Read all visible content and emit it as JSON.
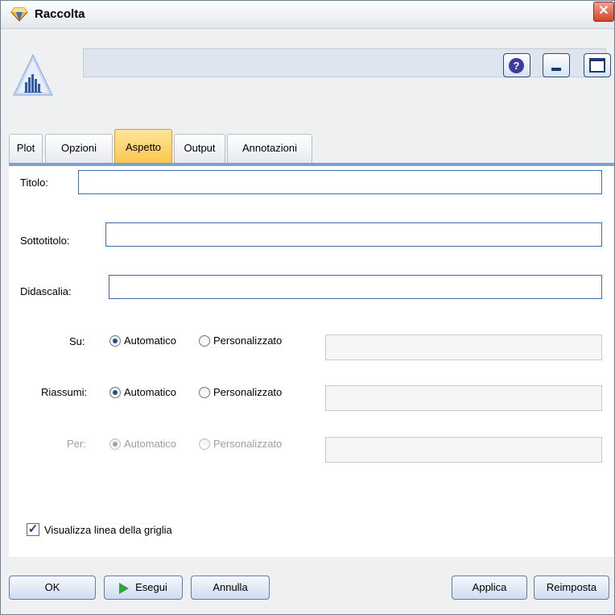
{
  "window": {
    "title": "Raccolta",
    "close_glyph": "✕",
    "help_glyph": "?"
  },
  "header": {
    "node_name_value": ""
  },
  "tabs": [
    {
      "label": "Plot",
      "active": false
    },
    {
      "label": "Opzioni",
      "active": false
    },
    {
      "label": "Aspetto",
      "active": true
    },
    {
      "label": "Output",
      "active": false
    },
    {
      "label": "Annotazioni",
      "active": false
    }
  ],
  "form": {
    "title_label": "Titolo:",
    "title_value": "",
    "subtitle_label": "Sottotitolo:",
    "subtitle_value": "",
    "caption_label": "Didascalia:",
    "caption_value": "",
    "su": {
      "label": "Su:",
      "option_auto": "Automatico",
      "option_custom": "Personalizzato",
      "selected": "Automatico",
      "value": ""
    },
    "riassumi": {
      "label": "Riassumi:",
      "option_auto": "Automatico",
      "option_custom": "Personalizzato",
      "selected": "Automatico",
      "value": ""
    },
    "per": {
      "label": "Per:",
      "option_auto": "Automatico",
      "option_custom": "Personalizzato",
      "selected": "Automatico",
      "enabled": false,
      "value": ""
    },
    "gridlines": {
      "label": "Visualizza linea della griglia",
      "checked": true
    }
  },
  "footer": {
    "ok": "OK",
    "run": "Esegui",
    "cancel": "Annulla",
    "apply": "Applica",
    "reset": "Reimposta"
  },
  "colors": {
    "active_tab": "#f8c64a",
    "field_border": "#3e6ab2",
    "run_icon": "#2fa43a",
    "close_button": "#d04528"
  }
}
